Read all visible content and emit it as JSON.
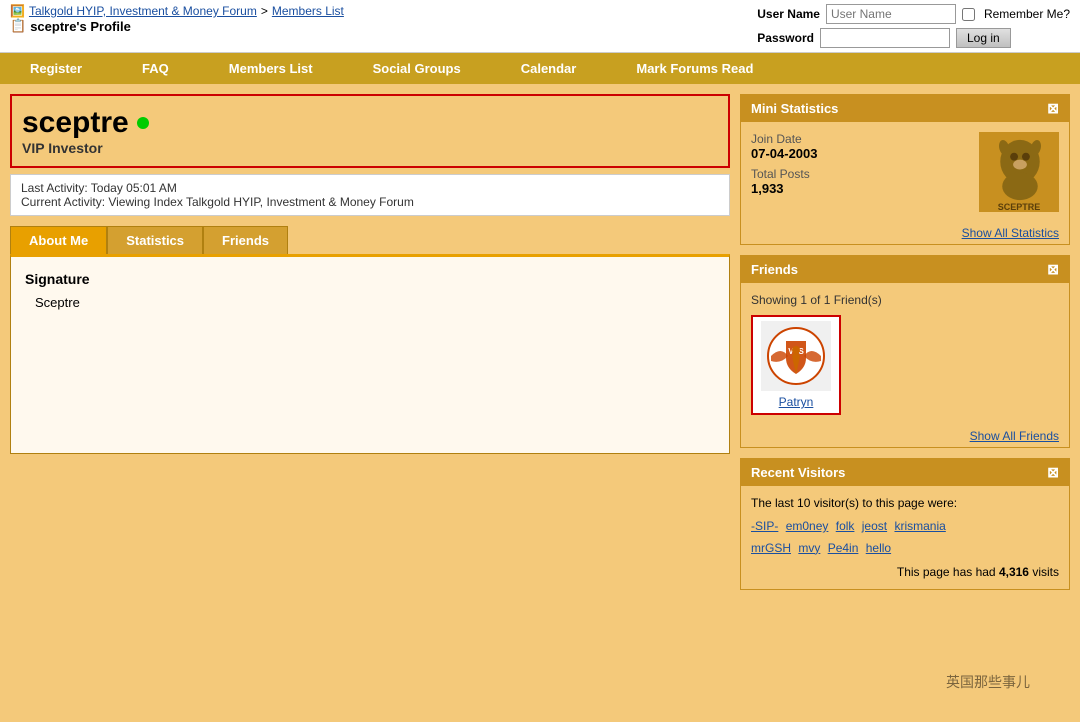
{
  "topbar": {
    "forum_name": "Talkgold HYIP, Investment & Money Forum",
    "members_list": "Members List",
    "profile_icon": "📋",
    "profile_title": "sceptre's Profile",
    "username_label": "User Name",
    "username_placeholder": "User Name",
    "password_label": "Password",
    "remember_me": "Remember Me?",
    "login_button": "Log in"
  },
  "nav": {
    "items": [
      "Register",
      "FAQ",
      "Members List",
      "Social Groups",
      "Calendar",
      "Mark Forums Read"
    ]
  },
  "profile": {
    "username": "sceptre",
    "title": "VIP Investor",
    "last_activity": "Last Activity: Today 05:01 AM",
    "current_activity": "Current Activity: Viewing Index Talkgold HYIP, Investment & Money Forum"
  },
  "tabs": {
    "items": [
      "About Me",
      "Statistics",
      "Friends"
    ],
    "active": "About Me"
  },
  "about_me": {
    "signature_label": "Signature",
    "signature_value": "Sceptre"
  },
  "mini_stats": {
    "title": "Mini Statistics",
    "join_date_label": "Join Date",
    "join_date_value": "07-04-2003",
    "total_posts_label": "Total Posts",
    "total_posts_value": "1,933",
    "avatar_text": "SCEPTRE",
    "show_all_label": "Show All Statistics"
  },
  "friends": {
    "title": "Friends",
    "showing_text": "Showing 1 of 1 Friend(s)",
    "items": [
      {
        "name": "Patryn"
      }
    ],
    "show_all_label": "Show All Friends"
  },
  "recent_visitors": {
    "title": "Recent Visitors",
    "description": "The last 10 visitor(s) to this page were:",
    "visitors": [
      "-SIP-",
      "em0ney",
      "folk",
      "jeost",
      "krismania",
      "mrGSH",
      "mvy",
      "Pe4in",
      "hello"
    ],
    "page_visits_prefix": "This page has had",
    "page_visits_count": "4,316",
    "page_visits_suffix": "visits"
  },
  "watermark": "英国那些事儿"
}
